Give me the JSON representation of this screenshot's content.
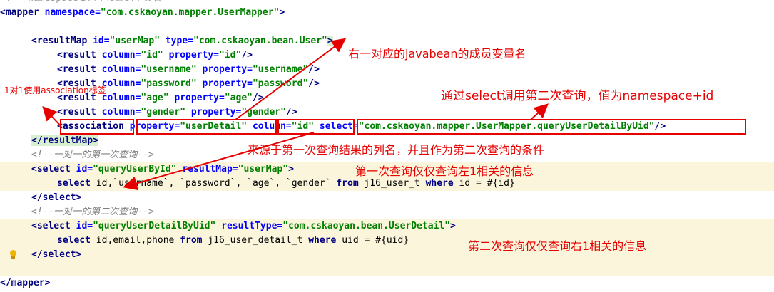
{
  "code": {
    "top_cut": "<!-- namespace要对于接口的全类名-->",
    "l1": [
      "<mapper ",
      "namespace=",
      "\"com.cskaoyan.mapper.UserMapper\"",
      ">"
    ],
    "l3": [
      "<resultMap ",
      "id=",
      "\"userMap\" ",
      "type=",
      "\"com.cskaoyan.bean.User\"",
      ">"
    ],
    "l4": [
      "<result ",
      "column=",
      "\"id\" ",
      "property=",
      "\"id\"",
      "/>"
    ],
    "l5": [
      "<result ",
      "column=",
      "\"username\" ",
      "property=",
      "\"username\"",
      "/>"
    ],
    "l6": [
      "<result ",
      "column=",
      "\"password\" ",
      "property=",
      "\"password\"",
      "/>"
    ],
    "l7": [
      "<result ",
      "column=",
      "\"age\" ",
      "property=",
      "\"age\"",
      "/>"
    ],
    "l8": [
      "<result ",
      "column=",
      "\"gender\" ",
      "property=",
      "\"gender\"",
      "/>"
    ],
    "l9": [
      "<association",
      " property=",
      "\"userDetail\"",
      " column=",
      "\"id\"",
      " select=",
      "\"com.cskaoyan.mapper.UserMapper.queryUserDetailByUid\"",
      "/>"
    ],
    "l10": "</resultMap>",
    "l11": "<!--一对一的第一次查询-->",
    "l12": [
      "<select ",
      "id=",
      "\"queryUserById\" ",
      "resultMap=",
      "\"userMap\"",
      ">"
    ],
    "l13": [
      "select",
      " id,`username`, `password`, `age`, `gender` ",
      "from",
      " j16_user_t ",
      "where",
      " id = #{id}"
    ],
    "l14": "</select>",
    "l15": "<!--一对一的第二次查询-->",
    "l16": [
      "<select ",
      "id=",
      "\"queryUserDetailByUid\" ",
      "resultType=",
      "\"com.cskaoyan.bean.UserDetail\"",
      ">"
    ],
    "l17": [
      "select",
      " id,email,phone ",
      "from",
      " j16_user_detail_t ",
      "where",
      " uid = #{uid}"
    ],
    "l18": "</select>",
    "l20": "</mapper>"
  },
  "annotations": {
    "a1": "右一对应的javabean的成员变量名",
    "a2": "1对1使用association标签",
    "a3": "通过select调用第二次查询，值为namespace+id",
    "a4": "来源于第一次查询结果的列名，并且作为第二次查询的条件",
    "a5": "第一次查询仅仅查询左1相关的信息",
    "a6": "第二次查询仅仅查询右1相关的信息"
  },
  "colors": {
    "annotation_red": "#e60000",
    "highlight": "#fbf5dc"
  },
  "icons": {
    "intention": "lightbulb-icon"
  }
}
